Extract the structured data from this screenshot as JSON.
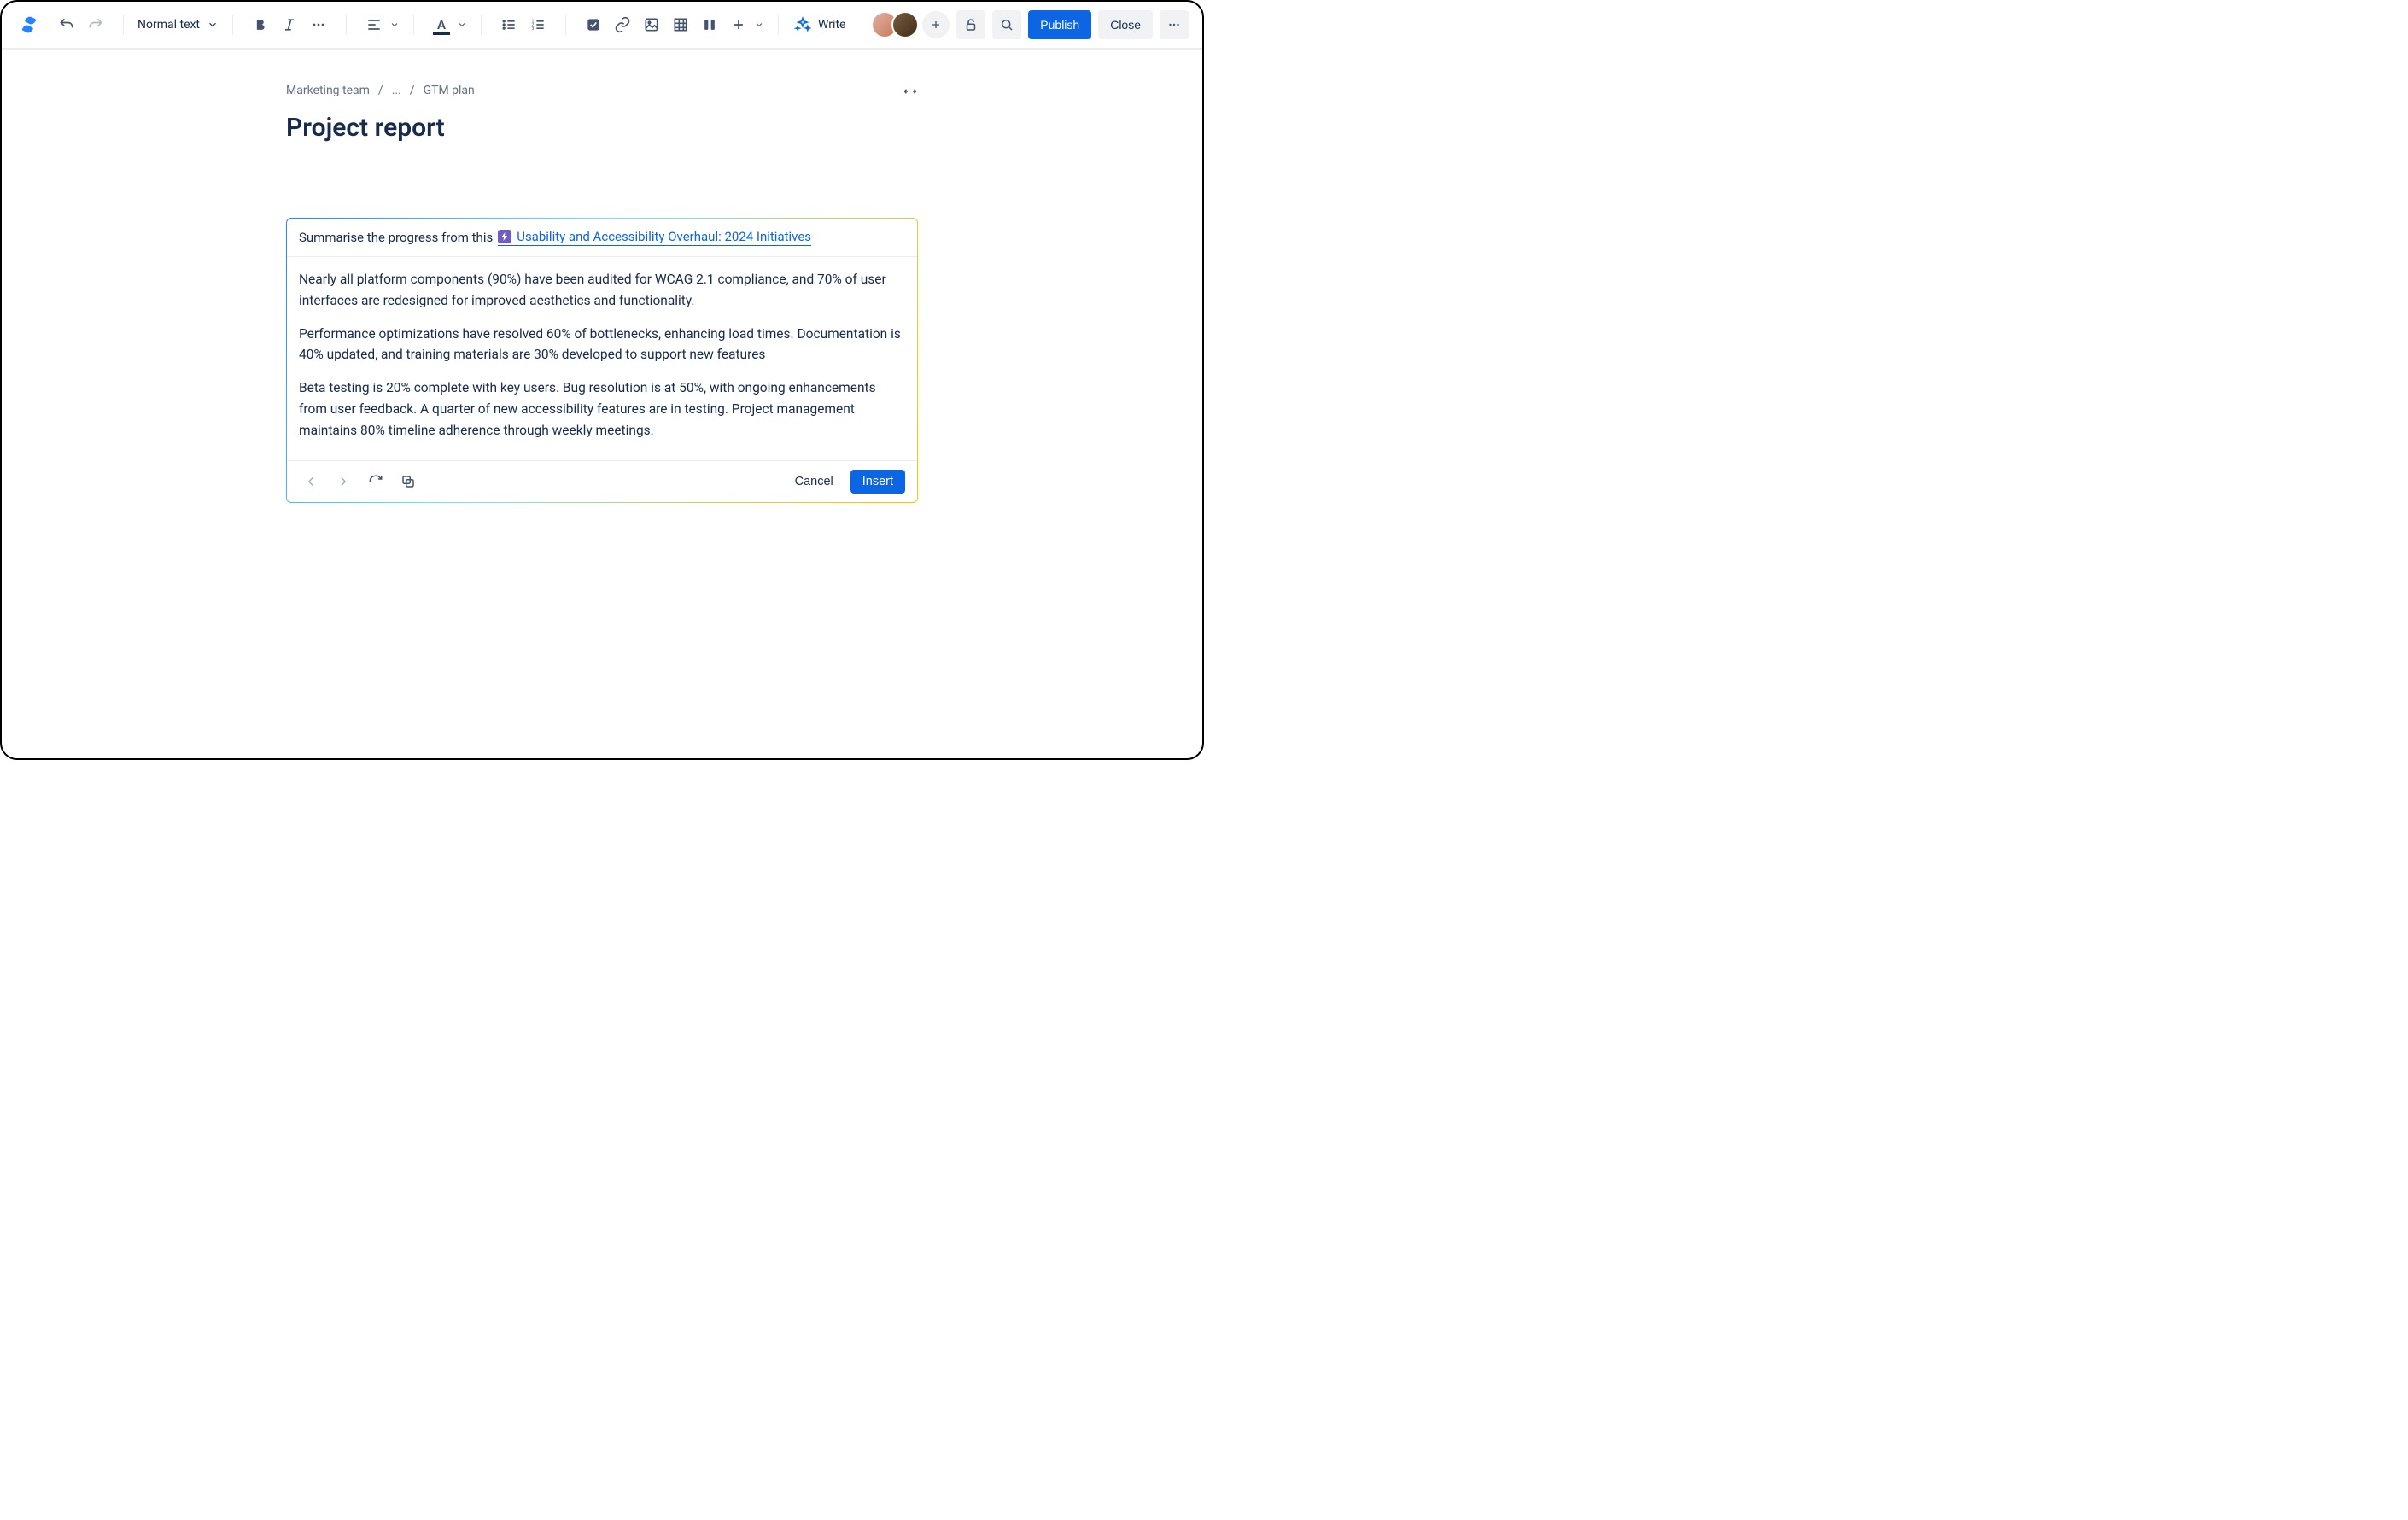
{
  "toolbar": {
    "text_style": "Normal text",
    "write_label": "Write",
    "publish_label": "Publish",
    "close_label": "Close"
  },
  "avatars": [
    {
      "bg": "#E2B0A0"
    },
    {
      "bg": "#7A5C3E"
    }
  ],
  "breadcrumb": {
    "items": [
      "Marketing team",
      "...",
      "GTM plan"
    ]
  },
  "page": {
    "title": "Project report"
  },
  "ai": {
    "prompt_prefix": "Summarise the progress from this",
    "mention": "Usability and Accessibility Overhaul: 2024 Initiatives",
    "paragraphs": [
      "Nearly all platform components (90%) have been audited for WCAG 2.1 compliance, and 70% of user interfaces are redesigned for improved aesthetics and functionality.",
      "Performance optimizations have resolved 60% of bottlenecks, enhancing load times. Documentation is 40% updated, and training materials are 30% developed to support new features",
      "Beta testing is 20% complete with key users. Bug resolution is at 50%, with ongoing enhancements from user feedback. A quarter of new accessibility features are in testing. Project management maintains 80% timeline adherence through weekly meetings."
    ],
    "cancel_label": "Cancel",
    "insert_label": "Insert"
  }
}
